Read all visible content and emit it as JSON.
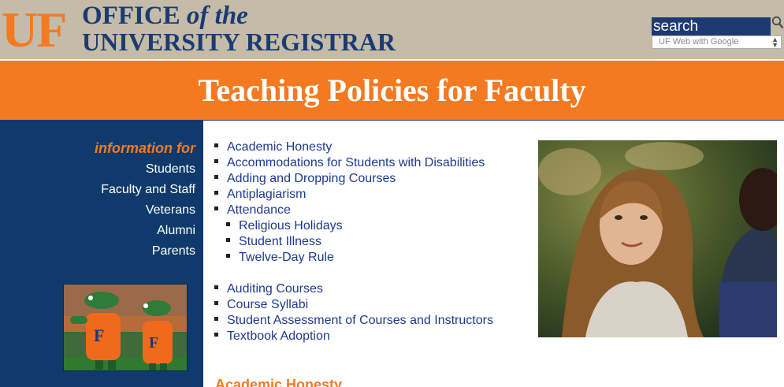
{
  "header": {
    "logo_text": "UF",
    "office_word": "OFFICE",
    "of_the": "of the",
    "line2": "UNIVERSITY REGISTRAR"
  },
  "search": {
    "label": "search",
    "select_value": "UF Web with Google"
  },
  "title": "Teaching Policies for Faculty",
  "sidebar": {
    "info_label": "information for",
    "links": [
      "Students",
      "Faculty and Staff",
      "Veterans",
      "Alumni",
      "Parents"
    ]
  },
  "policies": {
    "group1": [
      "Academic Honesty",
      "Accommodations for Students with Disabilities",
      "Adding and Dropping Courses",
      "Antiplagiarism",
      "Attendance"
    ],
    "attendance_sub": [
      "Religious Holidays",
      "Student Illness",
      "Twelve-Day Rule"
    ],
    "group2": [
      "Auditing Courses",
      "Course Syllabi",
      "Student Assessment of Courses and Instructors",
      "Textbook Adoption"
    ]
  },
  "section_heading": "Academic Honesty",
  "colors": {
    "orange": "#f37a21",
    "navy": "#1d3a73",
    "sidebar_blue": "#0f3a6b",
    "header_tan": "#c4bca9",
    "link_blue": "#1d3a8f"
  }
}
